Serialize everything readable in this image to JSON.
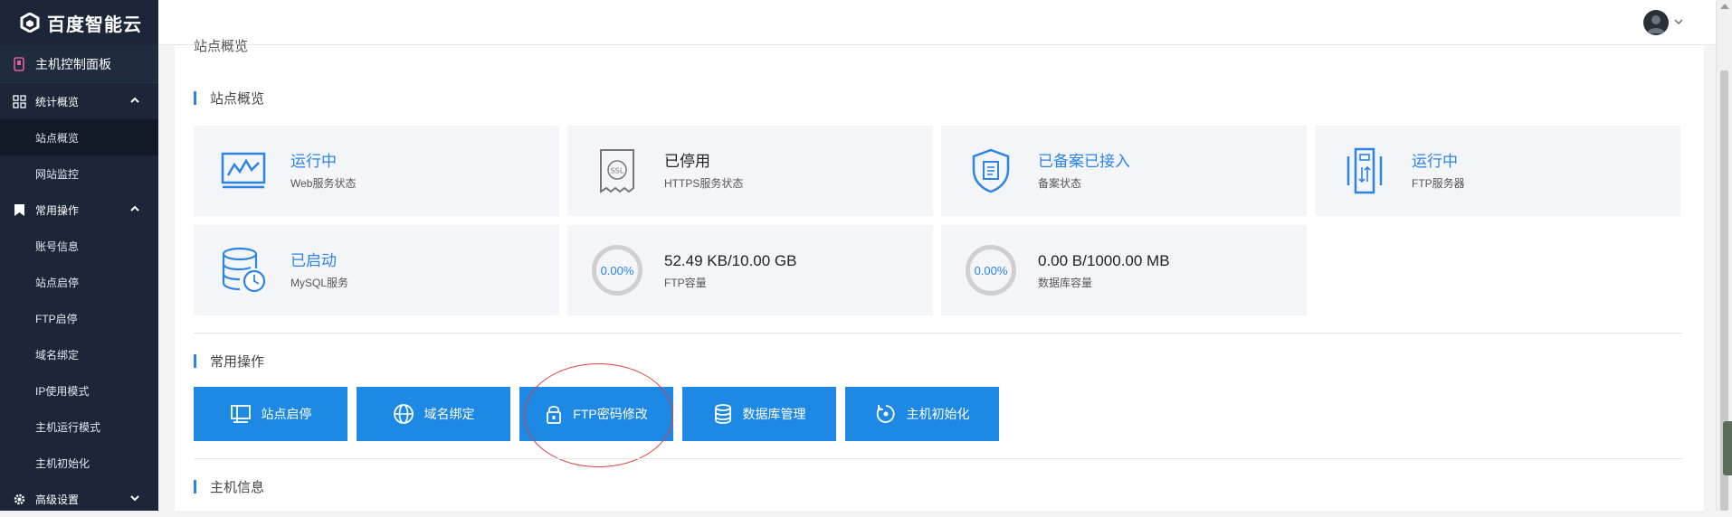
{
  "brand": {
    "name": "百度智能云"
  },
  "sidebar": {
    "top": {
      "label": "主机控制面板"
    },
    "groups": [
      {
        "label": "统计概览",
        "items": [
          "站点概览",
          "网站监控"
        ]
      },
      {
        "label": "常用操作",
        "items": [
          "账号信息",
          "站点启停",
          "FTP启停",
          "域名绑定",
          "IP使用模式",
          "主机运行模式",
          "主机初始化"
        ]
      },
      {
        "label": "高级设置",
        "items": []
      }
    ],
    "active_item": "站点概览"
  },
  "breadcrumb": "站点概览",
  "sections": {
    "overview_title": "站点概览",
    "ops_title": "常用操作",
    "host_title": "主机信息"
  },
  "cards": [
    {
      "value": "运行中",
      "label": "Web服务状态",
      "icon": "web-monitor-icon"
    },
    {
      "value": "已停用",
      "label": "HTTPS服务状态",
      "icon": "ssl-certificate-icon"
    },
    {
      "value": "已备案已接入",
      "label": "备案状态",
      "icon": "shield-document-icon"
    },
    {
      "value": "运行中",
      "label": "FTP服务器",
      "icon": "ftp-server-icon"
    },
    {
      "value": "已启动",
      "label": "MySQL服务",
      "icon": "database-clock-icon"
    },
    {
      "value": "52.49 KB/10.00 GB",
      "label": "FTP容量",
      "percent": "0.00%"
    },
    {
      "value": "0.00 B/1000.00 MB",
      "label": "数据库容量",
      "percent": "0.00%"
    }
  ],
  "operations": [
    {
      "label": "站点启停",
      "icon": "monitor-icon"
    },
    {
      "label": "域名绑定",
      "icon": "globe-icon"
    },
    {
      "label": "FTP密码修改",
      "icon": "lock-icon"
    },
    {
      "label": "数据库管理",
      "icon": "database-icon"
    },
    {
      "label": "主机初始化",
      "icon": "reset-icon"
    }
  ],
  "colors": {
    "accent": "#1e88e5",
    "sidebar": "#1c2638",
    "annotation": "#e23b3b"
  }
}
